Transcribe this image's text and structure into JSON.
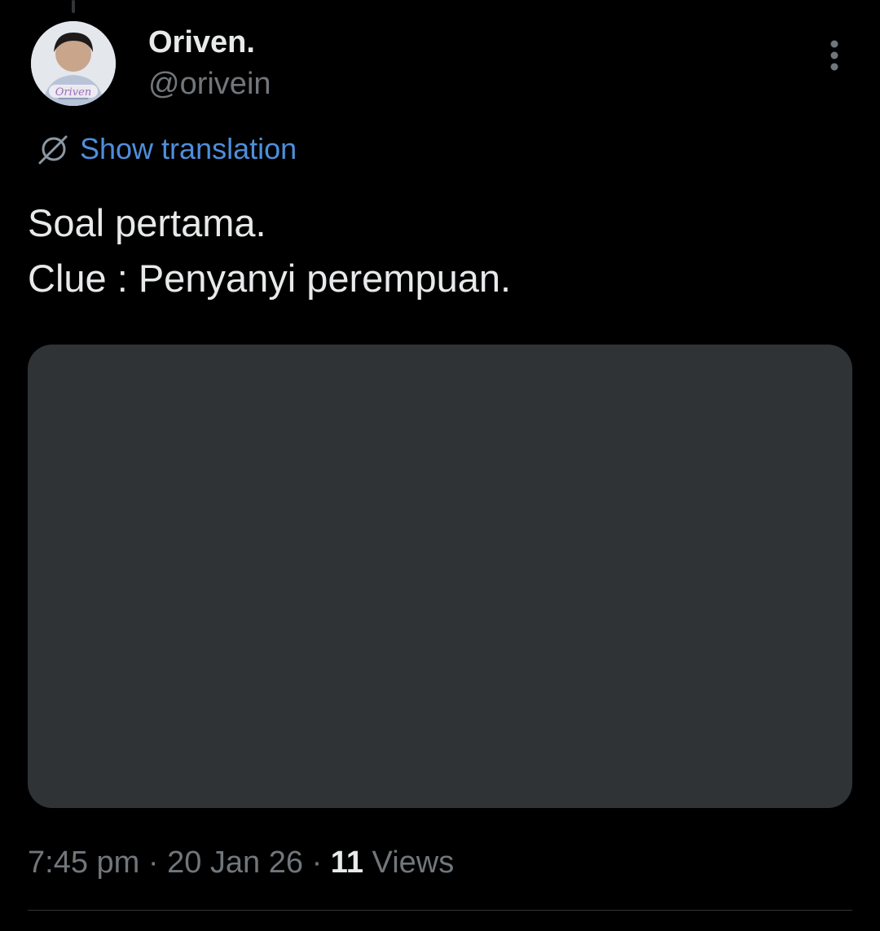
{
  "author": {
    "display_name": "Oriven.",
    "handle": "@orivein",
    "avatar_caption": "Oriven"
  },
  "translation": {
    "label": "Show translation",
    "icon": "translate-icon"
  },
  "tweet": {
    "lines": [
      "Soal pertama.",
      "Clue : Penyanyi perempuan."
    ]
  },
  "meta": {
    "time": "7:45 pm",
    "separator": "·",
    "date": "20 Jan 26",
    "views_count": "11",
    "views_label": "Views"
  },
  "icons": {
    "more": "more-vertical-icon",
    "translate": "translate-icon"
  },
  "colors": {
    "background": "#000000",
    "text_primary": "#e7e9ea",
    "text_secondary": "#71767b",
    "link": "#4f8edb",
    "media_placeholder": "#2f3336"
  }
}
